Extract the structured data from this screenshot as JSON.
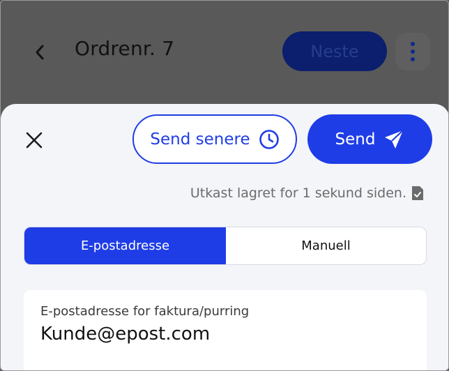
{
  "header": {
    "back_icon": "chevron-left-icon",
    "title": "Ordrenr. 7",
    "next_label": "Neste",
    "more_icon": "vertical-dots-icon"
  },
  "sheet": {
    "close_icon": "close-icon",
    "send_later_label": "Send senere",
    "send_later_icon": "clock-icon",
    "send_label": "Send",
    "send_icon": "paper-plane-icon",
    "draft_status": "Utkast lagret for 1 sekund siden.",
    "draft_icon": "document-check-icon",
    "tabs": [
      {
        "label": "E-postadresse",
        "active": true
      },
      {
        "label": "Manuell",
        "active": false
      }
    ],
    "email_field": {
      "label": "E-postadresse for faktura/purring",
      "value": "Kunde@epost.com"
    }
  },
  "colors": {
    "accent": "#1f3de6",
    "overlay": "#595959",
    "sheet_bg": "#f4f5f9"
  }
}
